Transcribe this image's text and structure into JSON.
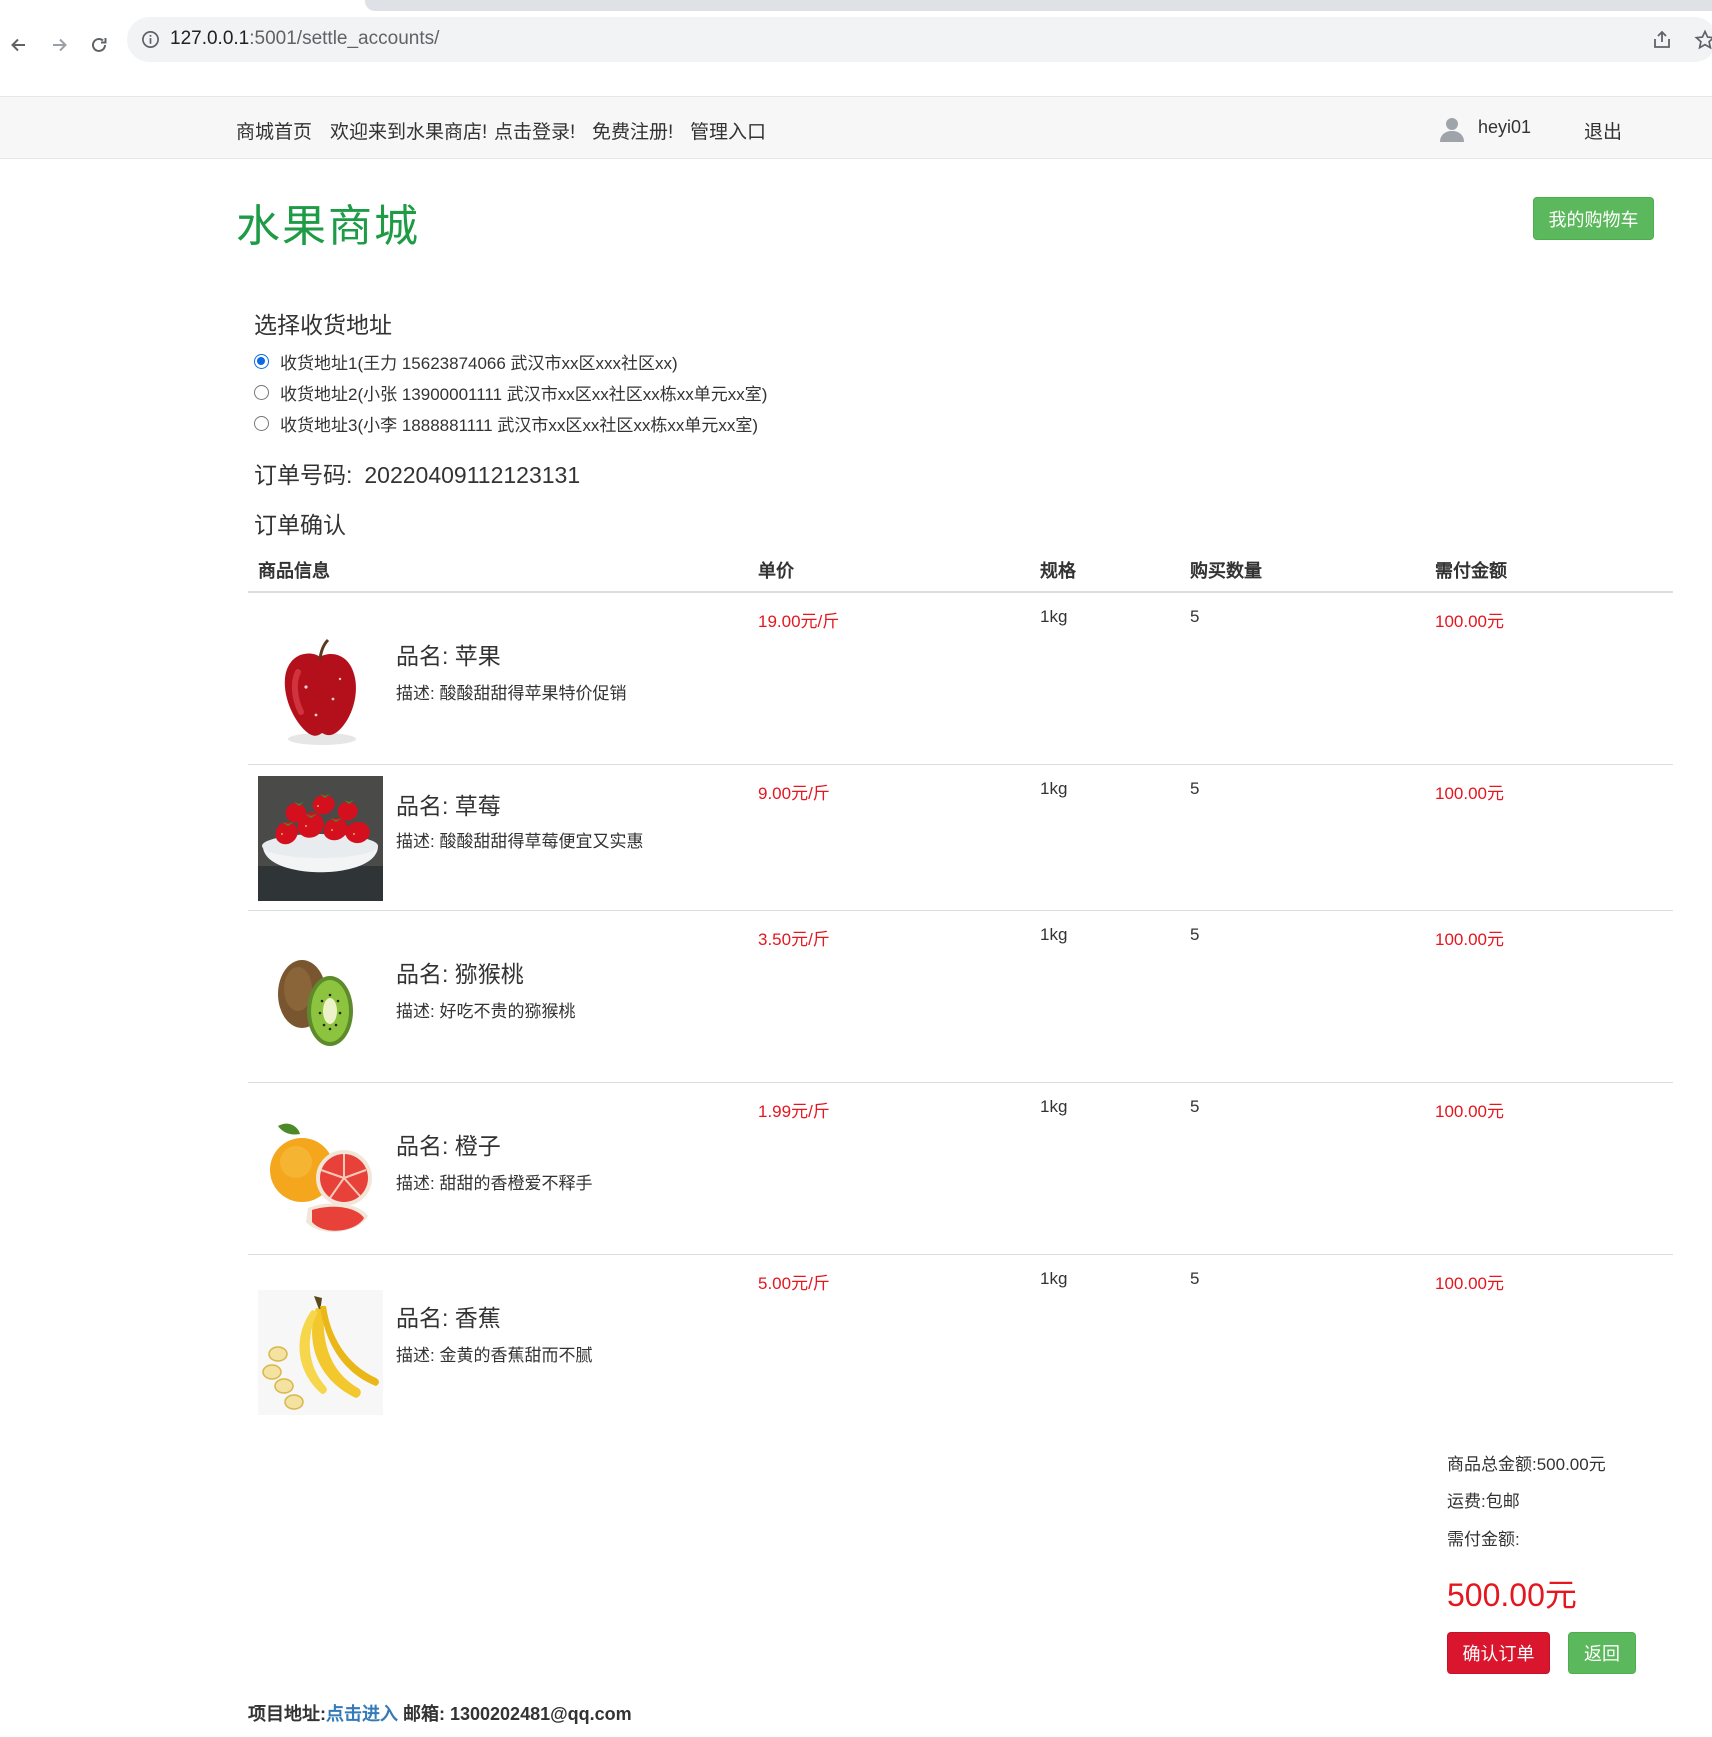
{
  "browser": {
    "url_host": "127.0.0.1",
    "url_port": ":5001",
    "url_path": "/settle_accounts/"
  },
  "topnav": {
    "home": "商城首页",
    "welcome": "欢迎来到水果商店!",
    "login": "点击登录!",
    "register": "免费注册!",
    "admin": "管理入口",
    "username": "heyi01",
    "logout": "退出"
  },
  "header": {
    "logo": "水果商城",
    "cart_button": "我的购物车"
  },
  "address": {
    "title": "选择收货地址",
    "options": [
      {
        "label": "收货地址1(王力 15623874066 武汉市xx区xxx社区xx)",
        "checked": true
      },
      {
        "label": "收货地址2(小张 13900001111 武汉市xx区xx社区xx栋xx单元xx室)",
        "checked": false
      },
      {
        "label": "收货地址3(小李 1888881111 武汉市xx区xx社区xx栋xx单元xx室)",
        "checked": false
      }
    ]
  },
  "order": {
    "number_label": "订单号码:",
    "number": "20220409112123131",
    "confirm_title": "订单确认"
  },
  "table": {
    "headers": [
      "商品信息",
      "单价",
      "规格",
      "购买数量",
      "需付金额"
    ],
    "items": [
      {
        "name": "品名:  苹果",
        "desc": "描述:  酸酸甜甜得苹果特价促销",
        "price": "19.00元/斤",
        "spec": "1kg",
        "qty": "5",
        "amount": "100.00元",
        "image": "apple"
      },
      {
        "name": "品名:  草莓",
        "desc": "描述:  酸酸甜甜得草莓便宜又实惠",
        "price": "9.00元/斤",
        "spec": "1kg",
        "qty": "5",
        "amount": "100.00元",
        "image": "strawberry"
      },
      {
        "name": "品名:  猕猴桃",
        "desc": "描述:  好吃不贵的猕猴桃",
        "price": "3.50元/斤",
        "spec": "1kg",
        "qty": "5",
        "amount": "100.00元",
        "image": "kiwi"
      },
      {
        "name": "品名:  橙子",
        "desc": "描述:  甜甜的香橙爱不释手",
        "price": "1.99元/斤",
        "spec": "1kg",
        "qty": "5",
        "amount": "100.00元",
        "image": "orange"
      },
      {
        "name": "品名:  香蕉",
        "desc": "描述:  金黄的香蕉甜而不腻",
        "price": "5.00元/斤",
        "spec": "1kg",
        "qty": "5",
        "amount": "100.00元",
        "image": "banana"
      }
    ]
  },
  "summary": {
    "goods_total": "商品总金额:500.00元",
    "shipping": "运费:包邮",
    "payable_label": "需付金额:",
    "payable": "500.00元",
    "confirm_button": "确认订单",
    "back_button": "返回"
  },
  "footer": {
    "project_label": "项目地址:",
    "project_link": "点击进入",
    "email": " 邮箱: 1300202481@qq.com"
  },
  "colors": {
    "accent_green": "#5cb85c",
    "logo_green": "#1d9b45",
    "price_red": "#e4161e",
    "confirm_red": "#d9162e"
  }
}
